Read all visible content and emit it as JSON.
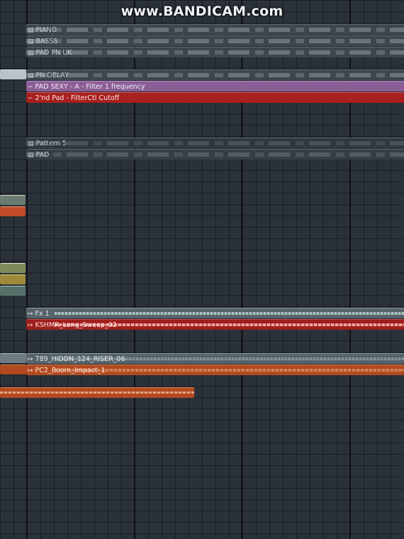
{
  "watermark": "www.BANDICAM.com",
  "icons": {
    "pattern": "pattern-icon",
    "automation": "automation-curve-icon",
    "audio": "audio-clip-icon"
  },
  "colors": {
    "pattern_clip": "#3d464e",
    "automation_purple": "#8b5f96",
    "automation_red": "#a8201f",
    "audio_grey": "#56636b",
    "audio_red": "#9e1e1c",
    "audio_orange": "#b24a20",
    "grid": "#2a3139"
  },
  "playlist": {
    "clips": [
      {
        "kind": "pattern",
        "label": "PIANO"
      },
      {
        "kind": "pattern",
        "label": "BASSS"
      },
      {
        "kind": "pattern",
        "label": "PAD PN UK"
      },
      {
        "kind": "pattern",
        "label": "PN DELAY"
      },
      {
        "kind": "automation",
        "label": "PAD SEXY - A - Filter 1 frequency"
      },
      {
        "kind": "automation",
        "label": "2'nd Pad - FilterCtl Cutoff"
      },
      {
        "kind": "pattern",
        "label": "Pattern 5"
      },
      {
        "kind": "pattern",
        "label": "PAD"
      },
      {
        "kind": "audio",
        "label": "Fx 1"
      },
      {
        "kind": "audio",
        "label": "KSHMR_Long_Sweep_02"
      },
      {
        "kind": "audio",
        "label": "789_HIDDN_124_RISER_06"
      },
      {
        "kind": "audio",
        "label": "PC2_Boom_Impact_1"
      }
    ]
  }
}
